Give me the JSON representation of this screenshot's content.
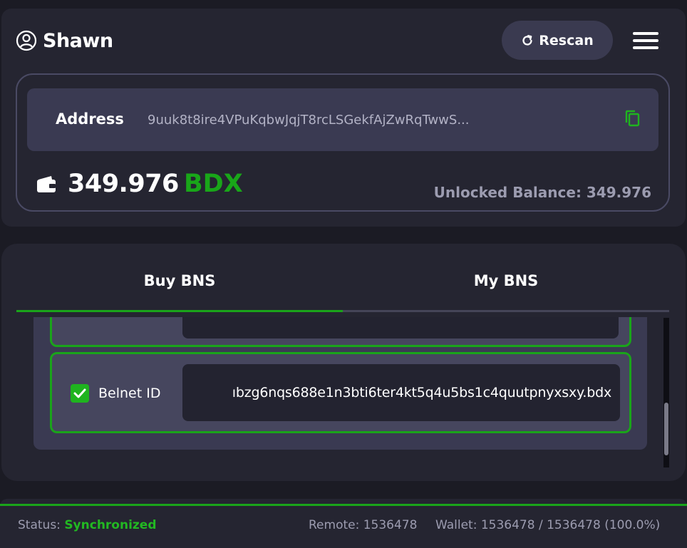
{
  "header": {
    "user_name": "Shawn",
    "user_icon": "user-circle-icon",
    "rescan_label": "Rescan",
    "rescan_icon": "refresh-icon",
    "menu_icon": "hamburger-menu-icon"
  },
  "wallet": {
    "address_label": "Address",
    "address_value": "9uuk8t8ire4VPuKqbwJqjT8rcLSGekfAjZwRqTwwS...",
    "copy_icon": "copy-icon",
    "wallet_icon": "wallet-icon",
    "balance_amount": "349.976",
    "balance_currency": "BDX",
    "unlocked_balance_text": "Unlocked Balance: 349.976"
  },
  "bns": {
    "tabs": [
      {
        "label": "Buy BNS",
        "active": true
      },
      {
        "label": "My BNS",
        "active": false
      }
    ],
    "items": [
      {
        "label": "Belnet ID",
        "checked": true,
        "value": "ıbzg6nqs688e1n3bti6ter4kt5q4u5bs1c4quutpnyxsxy.bdx"
      }
    ]
  },
  "status": {
    "status_label": "Status:",
    "status_value": "Synchronized",
    "remote_text": "Remote: 1536478",
    "wallet_text": "Wallet: 1536478 / 1536478 (100.0%)"
  },
  "colors": {
    "accent_green": "#1aa41a",
    "panel_bg": "#252531",
    "page_bg": "#1b1b24",
    "input_bg": "#232330"
  }
}
